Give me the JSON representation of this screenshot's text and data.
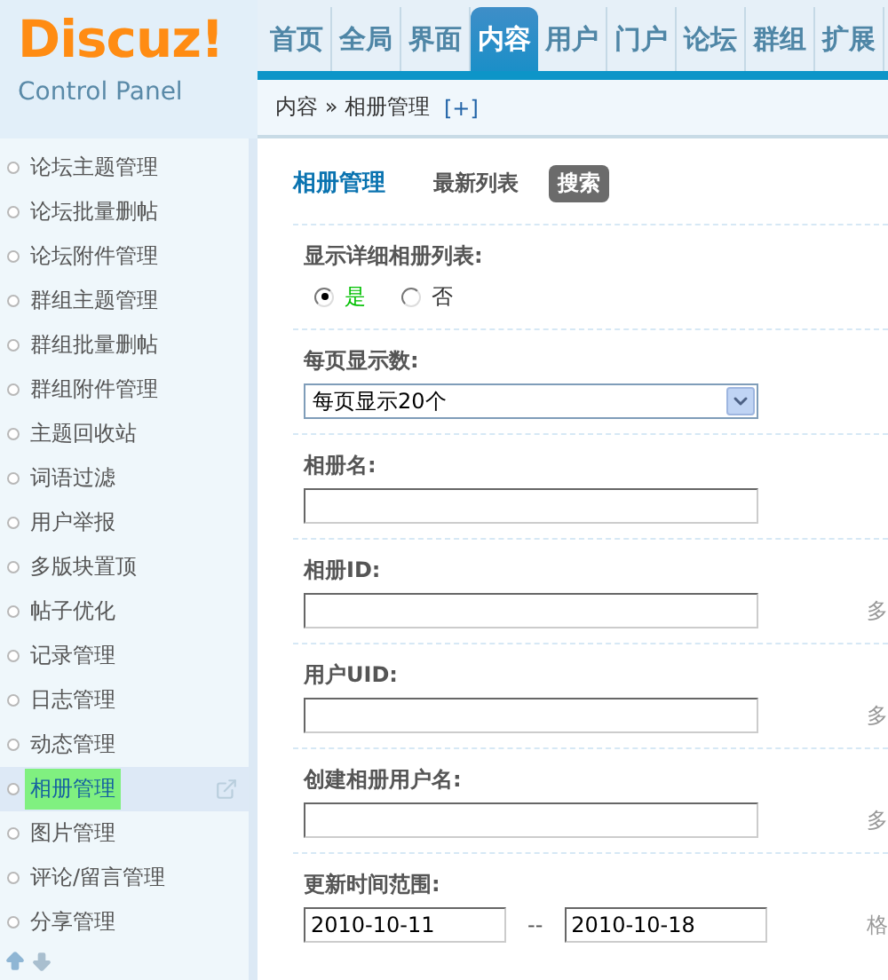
{
  "logo": {
    "brand": "Discuz!",
    "subtitle": "Control Panel"
  },
  "nav": [
    {
      "label": "首页",
      "selected": false
    },
    {
      "label": "全局",
      "selected": false
    },
    {
      "label": "界面",
      "selected": false
    },
    {
      "label": "内容",
      "selected": true
    },
    {
      "label": "用户",
      "selected": false
    },
    {
      "label": "门户",
      "selected": false
    },
    {
      "label": "论坛",
      "selected": false
    },
    {
      "label": "群组",
      "selected": false
    },
    {
      "label": "扩展",
      "selected": false
    }
  ],
  "breadcrumb": {
    "path": "内容 » 相册管理",
    "add": "[+]"
  },
  "sidebar": {
    "items": [
      {
        "label": "论坛主题管理",
        "selected": false
      },
      {
        "label": "论坛批量删帖",
        "selected": false
      },
      {
        "label": "论坛附件管理",
        "selected": false
      },
      {
        "label": "群组主题管理",
        "selected": false
      },
      {
        "label": "群组批量删帖",
        "selected": false
      },
      {
        "label": "群组附件管理",
        "selected": false
      },
      {
        "label": "主题回收站",
        "selected": false
      },
      {
        "label": "词语过滤",
        "selected": false
      },
      {
        "label": "用户举报",
        "selected": false
      },
      {
        "label": "多版块置顶",
        "selected": false
      },
      {
        "label": "帖子优化",
        "selected": false
      },
      {
        "label": "记录管理",
        "selected": false
      },
      {
        "label": "日志管理",
        "selected": false
      },
      {
        "label": "动态管理",
        "selected": false
      },
      {
        "label": "相册管理",
        "selected": true
      },
      {
        "label": "图片管理",
        "selected": false
      },
      {
        "label": "评论/留言管理",
        "selected": false
      },
      {
        "label": "分享管理",
        "selected": false
      }
    ]
  },
  "page": {
    "title": "相册管理",
    "tabs": [
      {
        "label": "最新列表",
        "selected": false
      },
      {
        "label": "搜索",
        "selected": true
      }
    ]
  },
  "form": {
    "rows": [
      {
        "kind": "radio",
        "label": "显示详细相册列表:",
        "options": [
          {
            "label": "是",
            "selected": true
          },
          {
            "label": "否",
            "selected": false
          }
        ]
      },
      {
        "kind": "select",
        "label": "每页显示数:",
        "value": "每页显示20个"
      },
      {
        "kind": "text",
        "label": "相册名:"
      },
      {
        "kind": "text",
        "label": "相册ID:",
        "hint": "多"
      },
      {
        "kind": "text",
        "label": "用户UID:",
        "hint": "多"
      },
      {
        "kind": "text",
        "label": "创建相册用户名:",
        "hint": "多"
      },
      {
        "kind": "range",
        "label": "更新时间范围:",
        "from": "2010-10-11",
        "separator": "--",
        "to": "2010-10-18",
        "hint": "格"
      }
    ]
  }
}
